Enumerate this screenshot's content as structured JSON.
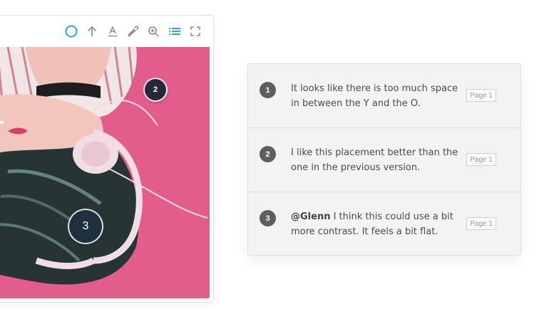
{
  "toolbar": {
    "tools": [
      {
        "icon": "circle-tool-icon",
        "active": true
      },
      {
        "icon": "arrow-up-icon"
      },
      {
        "icon": "text-underline-icon"
      },
      {
        "icon": "eyedropper-icon"
      },
      {
        "icon": "zoom-in-icon"
      },
      {
        "icon": "list-icon",
        "active": true
      },
      {
        "icon": "fullscreen-icon"
      }
    ],
    "active_color": "#29a8e0",
    "inactive_color": "#8e8e8e"
  },
  "pins": [
    {
      "number": "2"
    },
    {
      "number": "3"
    }
  ],
  "comments": [
    {
      "number": "1",
      "author": "",
      "text": "It looks like there is too much space in between the Y and the O.",
      "page": "Page 1"
    },
    {
      "number": "2",
      "author": "",
      "text": "I like this placement better than the one in the previous version.",
      "page": "Page 1"
    },
    {
      "number": "3",
      "author": "@Glenn",
      "text": " I think this could use a bit more contrast. It feels a bit flat.",
      "page": "Page 1"
    }
  ],
  "colors": {
    "photo_background": "#e35d8c",
    "comment_number": "#5e5e5e",
    "pin_dark": "#262737"
  }
}
